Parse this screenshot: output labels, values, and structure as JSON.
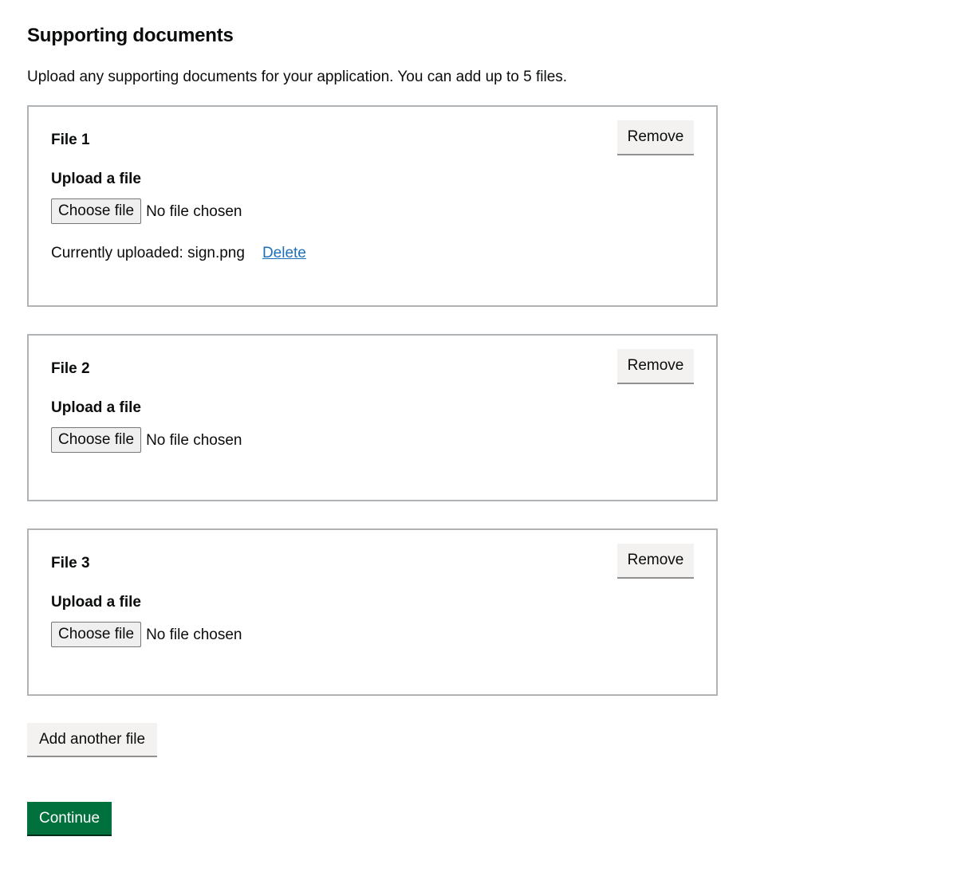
{
  "page": {
    "title": "Supporting documents",
    "hint": "Upload any supporting documents for your application. You can add up to 5 files."
  },
  "files": [
    {
      "heading": "File 1",
      "remove_label": "Remove",
      "upload_label": "Upload a file",
      "choose_label": "Choose file",
      "no_file_text": "No file chosen",
      "current_text": "Currently uploaded: sign.png",
      "delete_label": "Delete"
    },
    {
      "heading": "File 2",
      "remove_label": "Remove",
      "upload_label": "Upload a file",
      "choose_label": "Choose file",
      "no_file_text": "No file chosen"
    },
    {
      "heading": "File 3",
      "remove_label": "Remove",
      "upload_label": "Upload a file",
      "choose_label": "Choose file",
      "no_file_text": "No file chosen"
    }
  ],
  "actions": {
    "add_another_label": "Add another file",
    "continue_label": "Continue"
  },
  "colors": {
    "primary_button": "#00703c",
    "secondary_button": "#f3f2f1",
    "link": "#1d70b8",
    "border": "#b1b4b6",
    "text": "#0b0c0c"
  }
}
